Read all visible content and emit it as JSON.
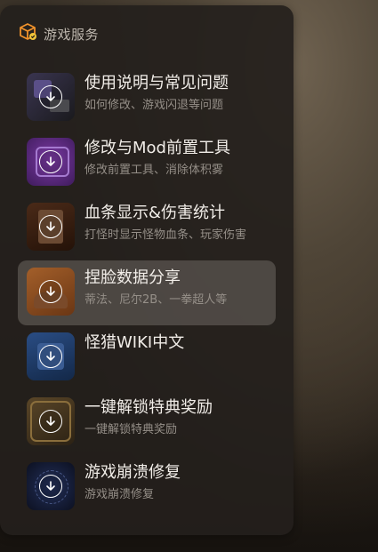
{
  "panel": {
    "title": "游戏服务",
    "icon": "game-box-icon"
  },
  "items": [
    {
      "title": "使用说明与常见问题",
      "subtitle": "如何修改、游戏闪退等问题",
      "icon": "download-icon",
      "thumb_color": "#2a2830"
    },
    {
      "title": "修改与Mod前置工具",
      "subtitle": "修改前置工具、消除体积雾",
      "icon": "download-icon",
      "thumb_color": "#5c2a7a"
    },
    {
      "title": "血条显示&伤害统计",
      "subtitle": "打怪时显示怪物血条、玩家伤害",
      "icon": "download-icon",
      "thumb_color": "#3b2216"
    },
    {
      "title": "捏脸数据分享",
      "subtitle": "蒂法、尼尔2B、一拳超人等",
      "icon": "download-icon",
      "thumb_color": "#8a4a1e"
    },
    {
      "title": "怪猎WIKI中文",
      "subtitle": "",
      "icon": "download-icon",
      "thumb_color": "#1e3a66"
    },
    {
      "title": "一键解锁特典奖励",
      "subtitle": "一键解锁特典奖励",
      "icon": "download-icon",
      "thumb_color": "#4a3a22"
    },
    {
      "title": "游戏崩溃修复",
      "subtitle": "游戏崩溃修复",
      "icon": "download-icon",
      "thumb_color": "#141a2e"
    }
  ],
  "colors": {
    "panel_bg": "#24201c",
    "selected_bg": "#6e6862",
    "accent": "#f0922b"
  }
}
